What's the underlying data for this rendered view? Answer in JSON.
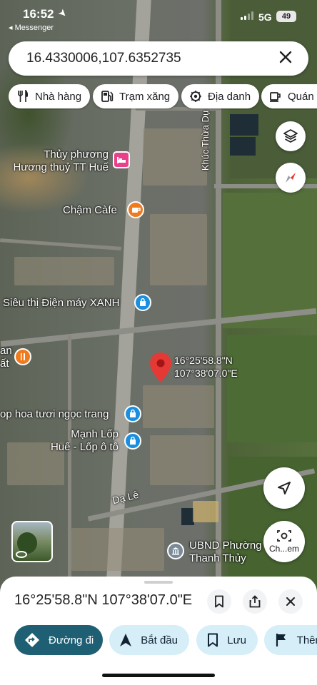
{
  "status_bar": {
    "time": "16:52",
    "back_label": "◂ Messenger",
    "network": "5G",
    "battery": "49"
  },
  "search": {
    "value": "16.4330006,107.6352735"
  },
  "chips": [
    {
      "label": "Nhà hàng",
      "icon": "restaurant-icon"
    },
    {
      "label": "Trạm xăng",
      "icon": "gas-station-icon"
    },
    {
      "label": "Địa danh",
      "icon": "landmark-icon"
    },
    {
      "label": "Quán c",
      "icon": "coffee-icon"
    }
  ],
  "map": {
    "road_label_vertical": "Khúc Thừa Dụ",
    "road_label_bottom": "Dạ Lê",
    "pin": {
      "lat": "16°25'58.8\"N",
      "lng": "107°38'07.0\"E"
    },
    "places": [
      {
        "line1": "Thủy phương",
        "line2": "Hương thuỷ TT Huế",
        "icon": "hotel-icon",
        "color": "#e8408a"
      },
      {
        "line1": "Chậm Càfe",
        "icon": "cafe-icon",
        "color": "#f07b1e"
      },
      {
        "line1": "Siêu thị Điện máy XANH",
        "icon": "shopping-bag-icon",
        "color": "#1a8fe0"
      },
      {
        "line1": "an",
        "line2": "ất",
        "icon": "restaurant-icon",
        "color": "#f07b1e"
      },
      {
        "line1": "op hoa tươi ngọc trang",
        "icon": "shopping-bag-icon",
        "color": "#1a8fe0"
      },
      {
        "line1": "Mạnh Lốp",
        "line2": "Huế - Lốp ô tô",
        "icon": "shopping-bag-icon",
        "color": "#1a8fe0"
      },
      {
        "line1": "UBND Phường",
        "line2": "Thanh Thủy",
        "icon": "government-icon",
        "color": "#7b8a99"
      }
    ],
    "chat_label": "Ch...em"
  },
  "sheet": {
    "coords": "16°25'58.8\"N 107°38'07.0\"E",
    "actions": [
      {
        "label": "Đường đi",
        "icon": "directions-icon"
      },
      {
        "label": "Bắt đầu",
        "icon": "navigation-arrow-icon"
      },
      {
        "label": "Lưu",
        "icon": "bookmark-icon"
      },
      {
        "label": "Thêm",
        "icon": "flag-icon"
      }
    ]
  }
}
